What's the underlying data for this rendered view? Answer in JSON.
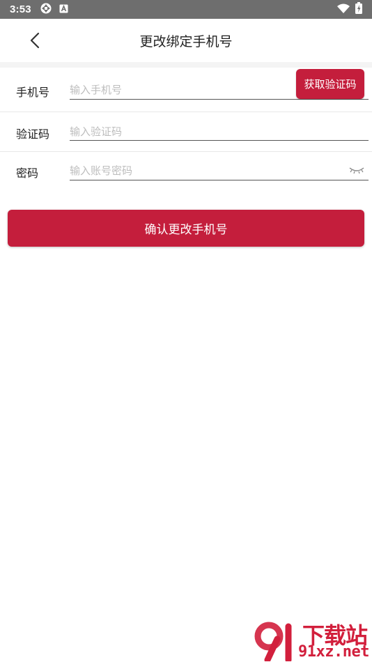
{
  "status_bar": {
    "time": "3:53",
    "left_icons": [
      "sync-icon",
      "a-app-icon"
    ],
    "right_icons": [
      "wifi-icon",
      "battery-icon"
    ]
  },
  "header": {
    "title": "更改绑定手机号",
    "back_icon": "chevron-left-icon"
  },
  "form": {
    "phone": {
      "label": "手机号",
      "placeholder": "输入手机号",
      "value": ""
    },
    "get_code_button": "获取验证码",
    "code": {
      "label": "验证码",
      "placeholder": "输入验证码",
      "value": ""
    },
    "password": {
      "label": "密码",
      "placeholder": "输入账号密码",
      "value": "",
      "toggle_icon": "eye-closed-icon"
    }
  },
  "confirm_button": "确认更改手机号",
  "watermark": {
    "top_text": "下载站",
    "bottom_text": "91xz.net"
  },
  "colors": {
    "accent": "#c41e3c",
    "status_bar": "#6e6e6e"
  }
}
